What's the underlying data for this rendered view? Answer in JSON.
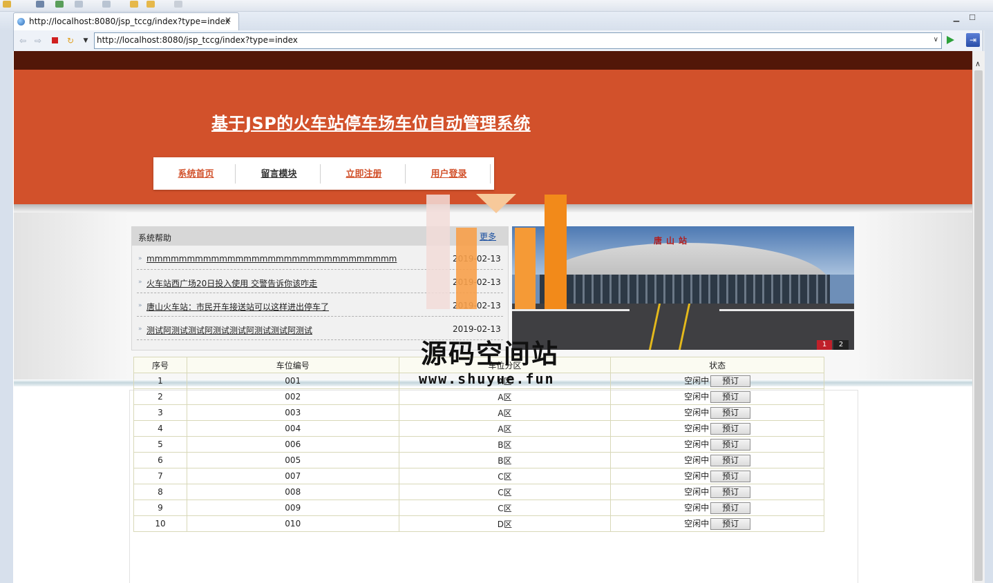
{
  "browser": {
    "tab_title": "http://localhost:8080/jsp_tccg/index?type=index",
    "url": "http://localhost:8080/jsp_tccg/index?type=index"
  },
  "site": {
    "title": "基于JSP的火车站停车场车位自动管理系统",
    "menu": [
      {
        "label": "系统首页",
        "color": "#d2512b"
      },
      {
        "label": "留言模块",
        "color": "#333333"
      },
      {
        "label": "立即注册",
        "color": "#d2512b"
      },
      {
        "label": "用户登录",
        "color": "#d2512b"
      }
    ],
    "brand_color": "#d2512b"
  },
  "help": {
    "title": "系统帮助",
    "more": "更多",
    "items": [
      {
        "title": "mmmmmmmmmmmmmmmmmmmmmmmmmmmmmmm",
        "date": "2019-02-13"
      },
      {
        "title": "火车站西广场20日投入使用 交警告诉你该咋走",
        "date": "2019-02-13"
      },
      {
        "title": "唐山火车站：市民开车接送站可以这样进出停车了",
        "date": "2019-02-13"
      },
      {
        "title": "测试阿测试测试阿测试测试阿测试测试阿测试",
        "date": "2019-02-13"
      }
    ]
  },
  "carousel": {
    "sign_text": "唐山站",
    "pages": [
      "1",
      "2"
    ],
    "active_page": "1"
  },
  "watermark": {
    "text": "源码空间站",
    "url": "www.shuyue.fun"
  },
  "slots": {
    "headers": [
      "序号",
      "车位编号",
      "车位分区",
      "状态"
    ],
    "book_label": "预订",
    "rows": [
      {
        "no": "1",
        "code": "001",
        "zone": "A区",
        "status": "空闲中"
      },
      {
        "no": "2",
        "code": "002",
        "zone": "A区",
        "status": "空闲中"
      },
      {
        "no": "3",
        "code": "003",
        "zone": "A区",
        "status": "空闲中"
      },
      {
        "no": "4",
        "code": "004",
        "zone": "A区",
        "status": "空闲中"
      },
      {
        "no": "5",
        "code": "006",
        "zone": "B区",
        "status": "空闲中"
      },
      {
        "no": "6",
        "code": "005",
        "zone": "B区",
        "status": "空闲中"
      },
      {
        "no": "7",
        "code": "007",
        "zone": "C区",
        "status": "空闲中"
      },
      {
        "no": "8",
        "code": "008",
        "zone": "C区",
        "status": "空闲中"
      },
      {
        "no": "9",
        "code": "009",
        "zone": "C区",
        "status": "空闲中"
      },
      {
        "no": "10",
        "code": "010",
        "zone": "D区",
        "status": "空闲中"
      }
    ]
  }
}
